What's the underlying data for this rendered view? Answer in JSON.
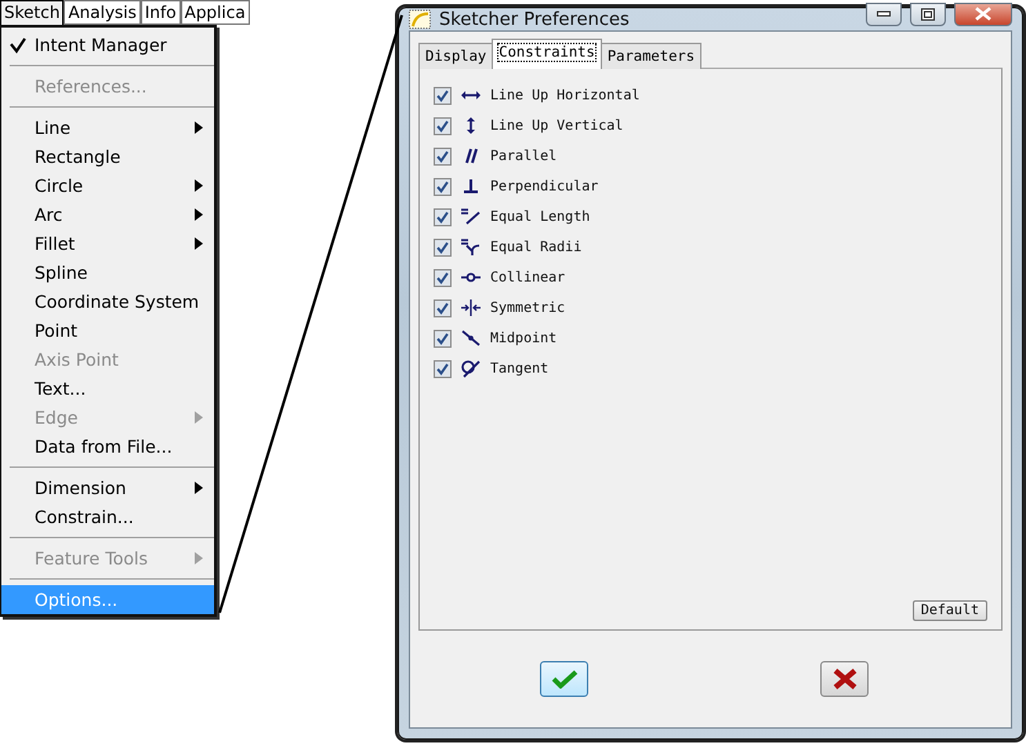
{
  "menubar": [
    {
      "label": "Sketch",
      "selected": true
    },
    {
      "label": "Analysis",
      "selected": false
    },
    {
      "label": "Info",
      "selected": false
    },
    {
      "label": "Applica",
      "selected": false
    }
  ],
  "menu": {
    "items": [
      {
        "kind": "item",
        "label": "Intent Manager",
        "checked": true,
        "disabled": false,
        "submenu": false,
        "selected": false
      },
      {
        "kind": "separator"
      },
      {
        "kind": "item",
        "label": "References...",
        "checked": false,
        "disabled": true,
        "submenu": false,
        "selected": false
      },
      {
        "kind": "separator"
      },
      {
        "kind": "item",
        "label": "Line",
        "checked": false,
        "disabled": false,
        "submenu": true,
        "selected": false
      },
      {
        "kind": "item",
        "label": "Rectangle",
        "checked": false,
        "disabled": false,
        "submenu": false,
        "selected": false
      },
      {
        "kind": "item",
        "label": "Circle",
        "checked": false,
        "disabled": false,
        "submenu": true,
        "selected": false
      },
      {
        "kind": "item",
        "label": "Arc",
        "checked": false,
        "disabled": false,
        "submenu": true,
        "selected": false
      },
      {
        "kind": "item",
        "label": "Fillet",
        "checked": false,
        "disabled": false,
        "submenu": true,
        "selected": false
      },
      {
        "kind": "item",
        "label": "Spline",
        "checked": false,
        "disabled": false,
        "submenu": false,
        "selected": false
      },
      {
        "kind": "item",
        "label": "Coordinate System",
        "checked": false,
        "disabled": false,
        "submenu": false,
        "selected": false
      },
      {
        "kind": "item",
        "label": "Point",
        "checked": false,
        "disabled": false,
        "submenu": false,
        "selected": false
      },
      {
        "kind": "item",
        "label": "Axis Point",
        "checked": false,
        "disabled": true,
        "submenu": false,
        "selected": false
      },
      {
        "kind": "item",
        "label": "Text...",
        "checked": false,
        "disabled": false,
        "submenu": false,
        "selected": false
      },
      {
        "kind": "item",
        "label": "Edge",
        "checked": false,
        "disabled": true,
        "submenu": true,
        "selected": false
      },
      {
        "kind": "item",
        "label": "Data from File...",
        "checked": false,
        "disabled": false,
        "submenu": false,
        "selected": false
      },
      {
        "kind": "separator"
      },
      {
        "kind": "item",
        "label": "Dimension",
        "checked": false,
        "disabled": false,
        "submenu": true,
        "selected": false
      },
      {
        "kind": "item",
        "label": "Constrain...",
        "checked": false,
        "disabled": false,
        "submenu": false,
        "selected": false
      },
      {
        "kind": "separator"
      },
      {
        "kind": "item",
        "label": "Feature Tools",
        "checked": false,
        "disabled": true,
        "submenu": true,
        "selected": false
      },
      {
        "kind": "separator"
      },
      {
        "kind": "item",
        "label": "Options...",
        "checked": false,
        "disabled": false,
        "submenu": false,
        "selected": true
      }
    ]
  },
  "dialog": {
    "title": "Sketcher Preferences",
    "tabs": [
      {
        "label": "Display",
        "selected": false
      },
      {
        "label": "Constraints",
        "selected": true
      },
      {
        "label": "Parameters",
        "selected": false
      }
    ],
    "constraints": [
      {
        "kind": "horizontal",
        "label": "Line Up Horizontal",
        "checked": true
      },
      {
        "kind": "vertical",
        "label": "Line Up Vertical",
        "checked": true
      },
      {
        "kind": "parallel",
        "label": "Parallel",
        "checked": true
      },
      {
        "kind": "perpendicular",
        "label": "Perpendicular",
        "checked": true
      },
      {
        "kind": "equal_length",
        "label": "Equal Length",
        "checked": true
      },
      {
        "kind": "equal_radii",
        "label": "Equal Radii",
        "checked": true
      },
      {
        "kind": "collinear",
        "label": "Collinear",
        "checked": true
      },
      {
        "kind": "symmetric",
        "label": "Symmetric",
        "checked": true
      },
      {
        "kind": "midpoint",
        "label": "Midpoint",
        "checked": true
      },
      {
        "kind": "tangent",
        "label": "Tangent",
        "checked": true
      }
    ],
    "default_button": "Default"
  }
}
